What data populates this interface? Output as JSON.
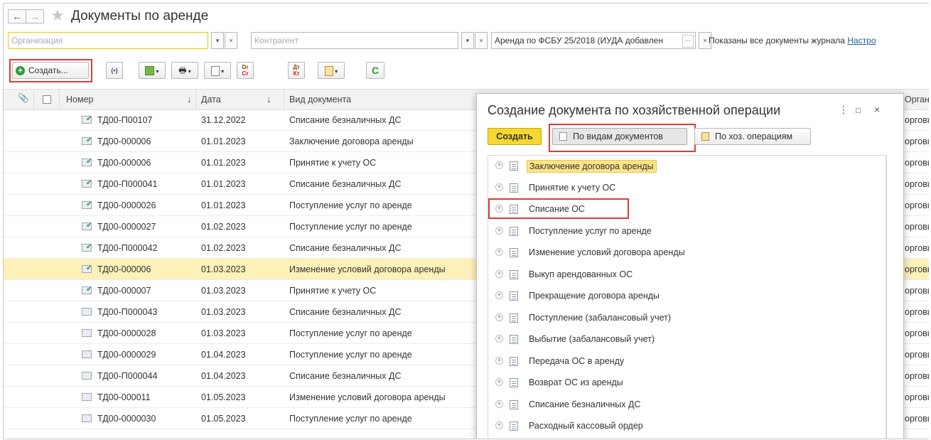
{
  "window": {
    "title": "Документы по аренде",
    "back": "←",
    "forward": "→",
    "star": "★"
  },
  "filters": {
    "organization_placeholder": "Организация",
    "counterparty_placeholder": "Контрагент",
    "arenda_value": "Аренда по ФСБУ 25/2018 (ИУДА добавлен",
    "more": "...",
    "dropdown": "▾",
    "clear": "×",
    "shown_text": "Показаны все документы журнала",
    "settings_link": "Настро"
  },
  "toolbar": {
    "create_label": "Создать...",
    "radio_icon": "(•)",
    "dt": "Dr",
    "ct": "Cr",
    "dt_ru": "Дт",
    "kt_ru": "Кт",
    "refresh": "C"
  },
  "table": {
    "columns": [
      "Номер",
      "Дата",
      "Вид документа",
      "Органи"
    ],
    "sort_arrow": "↓",
    "rows": [
      {
        "number": "ТД00-П00107",
        "date": "31.12.2022",
        "type": "Списание безналичных ДС",
        "org": "орговы",
        "posted": true
      },
      {
        "number": "ТД00-000006",
        "date": "01.01.2023",
        "type": "Заключение договора аренды",
        "org": "орговы",
        "posted": true
      },
      {
        "number": "ТД00-000006",
        "date": "01.01.2023",
        "type": "Принятие к учету ОС",
        "org": "орговы",
        "posted": true
      },
      {
        "number": "ТД00-П000041",
        "date": "01.01.2023",
        "type": "Списание безналичных ДС",
        "org": "орговы",
        "posted": true
      },
      {
        "number": "ТД00-0000026",
        "date": "01.01.2023",
        "type": "Поступление услуг по аренде",
        "org": "орговы",
        "posted": true
      },
      {
        "number": "ТД00-0000027",
        "date": "01.02.2023",
        "type": "Поступление услуг по аренде",
        "org": "орговы",
        "posted": true
      },
      {
        "number": "ТД00-П000042",
        "date": "01.02.2023",
        "type": "Списание безналичных ДС",
        "org": "орговы",
        "posted": true
      },
      {
        "number": "ТД00-000006",
        "date": "01.03.2023",
        "type": "Изменение условий договора аренды",
        "org": "орговы",
        "posted": true,
        "selected": true
      },
      {
        "number": "ТД00-000007",
        "date": "01.03.2023",
        "type": "Принятие к учету ОС",
        "org": "орговы",
        "posted": true
      },
      {
        "number": "ТД00-П000043",
        "date": "01.03.2023",
        "type": "Списание безналичных ДС",
        "org": "орговы",
        "posted": false
      },
      {
        "number": "ТД00-0000028",
        "date": "01.03.2023",
        "type": "Поступление услуг по аренде",
        "org": "орговы",
        "posted": false
      },
      {
        "number": "ТД00-0000029",
        "date": "01.04.2023",
        "type": "Поступление услуг по аренде",
        "org": "орговы",
        "posted": false
      },
      {
        "number": "ТД00-П000044",
        "date": "01.04.2023",
        "type": "Списание безналичных ДС",
        "org": "орговы",
        "posted": false
      },
      {
        "number": "ТД00-000011",
        "date": "01.05.2023",
        "type": "Изменение условий договора аренды",
        "org": "орговы",
        "posted": false
      },
      {
        "number": "ТД00-0000030",
        "date": "01.05.2023",
        "type": "Поступление услуг по аренде",
        "org": "орговы",
        "posted": false
      }
    ]
  },
  "dialog": {
    "title": "Создание документа по хозяйственной операции",
    "menu": "⋮",
    "maximize": "□",
    "close": "×",
    "create_label": "Создать",
    "by_kind_label": "По видам документов",
    "by_operation_label": "По хоз. операциям",
    "items": [
      "Заключение договора аренды",
      "Принятие к учету ОС",
      "Списание ОС",
      "Поступление услуг по аренде",
      "Изменение условий договора аренды",
      "Выкуп арендованных ОС",
      "Прекращение договора аренды",
      "Поступление (забалансовый учет)",
      "Выбытие (забалансовый учет)",
      "Передача ОС в аренду",
      "Возврат ОС из аренды",
      "Списание безналичных ДС",
      "Расходный кассовый ордер"
    ],
    "expand": "+"
  },
  "colors": {
    "accent_yellow": "#f6d631",
    "selected_row": "#fdf0b8",
    "highlight_box": "#e03a3a",
    "create_green": "#2f9a3b",
    "link_blue": "#1d5fa3"
  }
}
